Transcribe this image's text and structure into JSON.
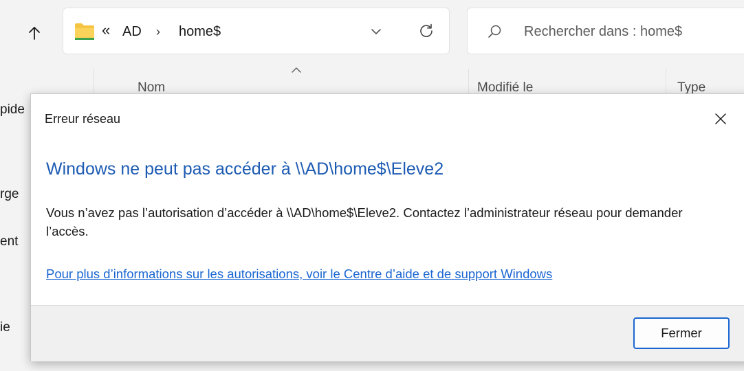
{
  "toolbar": {
    "up_icon": "arrow-up-icon",
    "address": {
      "folder_icon": "folder-icon",
      "overflow_glyph": "«",
      "crumbs": [
        "AD",
        "home$"
      ],
      "separator": "›",
      "dropdown_icon": "chevron-down-icon",
      "refresh_icon": "refresh-icon"
    },
    "search": {
      "icon": "search-icon",
      "placeholder": "Rechercher dans : home$"
    }
  },
  "columns": {
    "sort_icon": "sort-up-icon",
    "headers": [
      "Nom",
      "Modifié le",
      "Type"
    ]
  },
  "sidebar": {
    "partial_labels": [
      "pide",
      "rge",
      "ent",
      "ie"
    ]
  },
  "dialog": {
    "title": "Erreur réseau",
    "close_icon": "close-icon",
    "heading": "Windows ne peut pas accéder à \\\\AD\\home$\\Eleve2",
    "message": "Vous n’avez pas l’autorisation d’accéder à \\\\AD\\home$\\Eleve2. Contactez l’administrateur réseau pour demander l’accès.",
    "help_link": "Pour plus d’informations sur les autorisations, voir le Centre d’aide et de support Windows",
    "close_button": "Fermer"
  },
  "colors": {
    "heading": "#1d5bb3",
    "link": "#1a66d2",
    "folder": "#f6c443"
  }
}
